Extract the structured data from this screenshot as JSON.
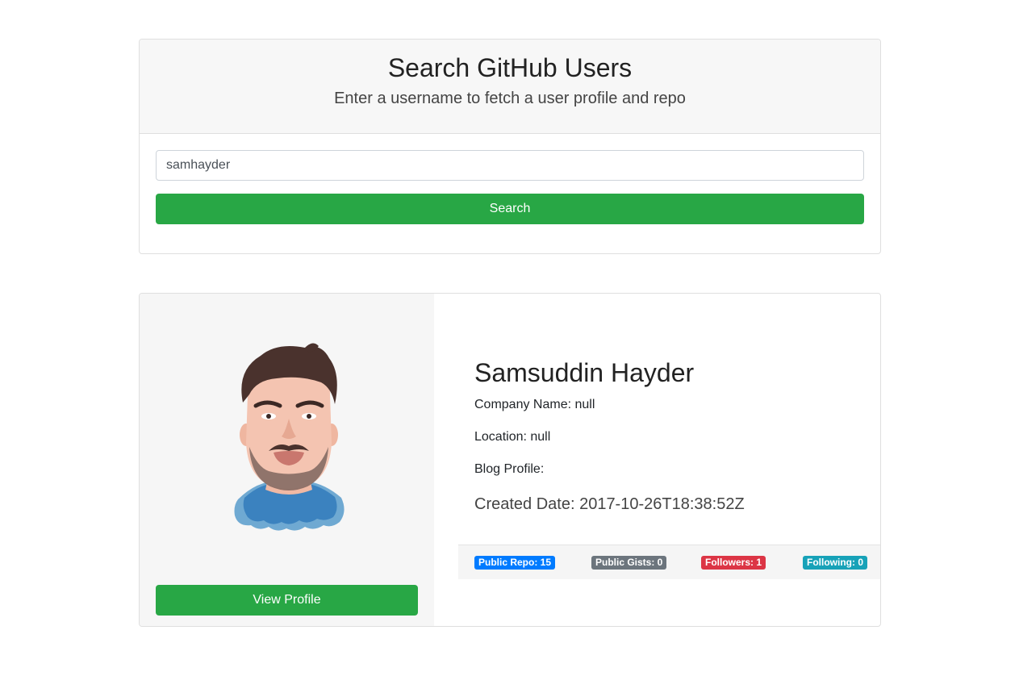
{
  "search": {
    "title": "Search GitHub Users",
    "subtitle": "Enter a username to fetch a user profile and repo",
    "input_value": "samhayder",
    "button_label": "Search"
  },
  "profile": {
    "name": "Samsuddin Hayder",
    "company": "Company Name: null",
    "location": "Location: null",
    "blog": "Blog Profile:",
    "created": "Created Date: 2017-10-26T18:38:52Z",
    "view_profile_label": "View Profile",
    "avatar_icon": "cartoon-avatar-icon",
    "badges": {
      "repos": "Public Repo: 15",
      "gists": "Public Gists: 0",
      "followers": "Followers: 1",
      "following": "Following: 0"
    }
  },
  "colors": {
    "primary": "#007bff",
    "secondary": "#6c757d",
    "danger": "#dc3545",
    "info": "#17a2b8",
    "success": "#28a745"
  }
}
